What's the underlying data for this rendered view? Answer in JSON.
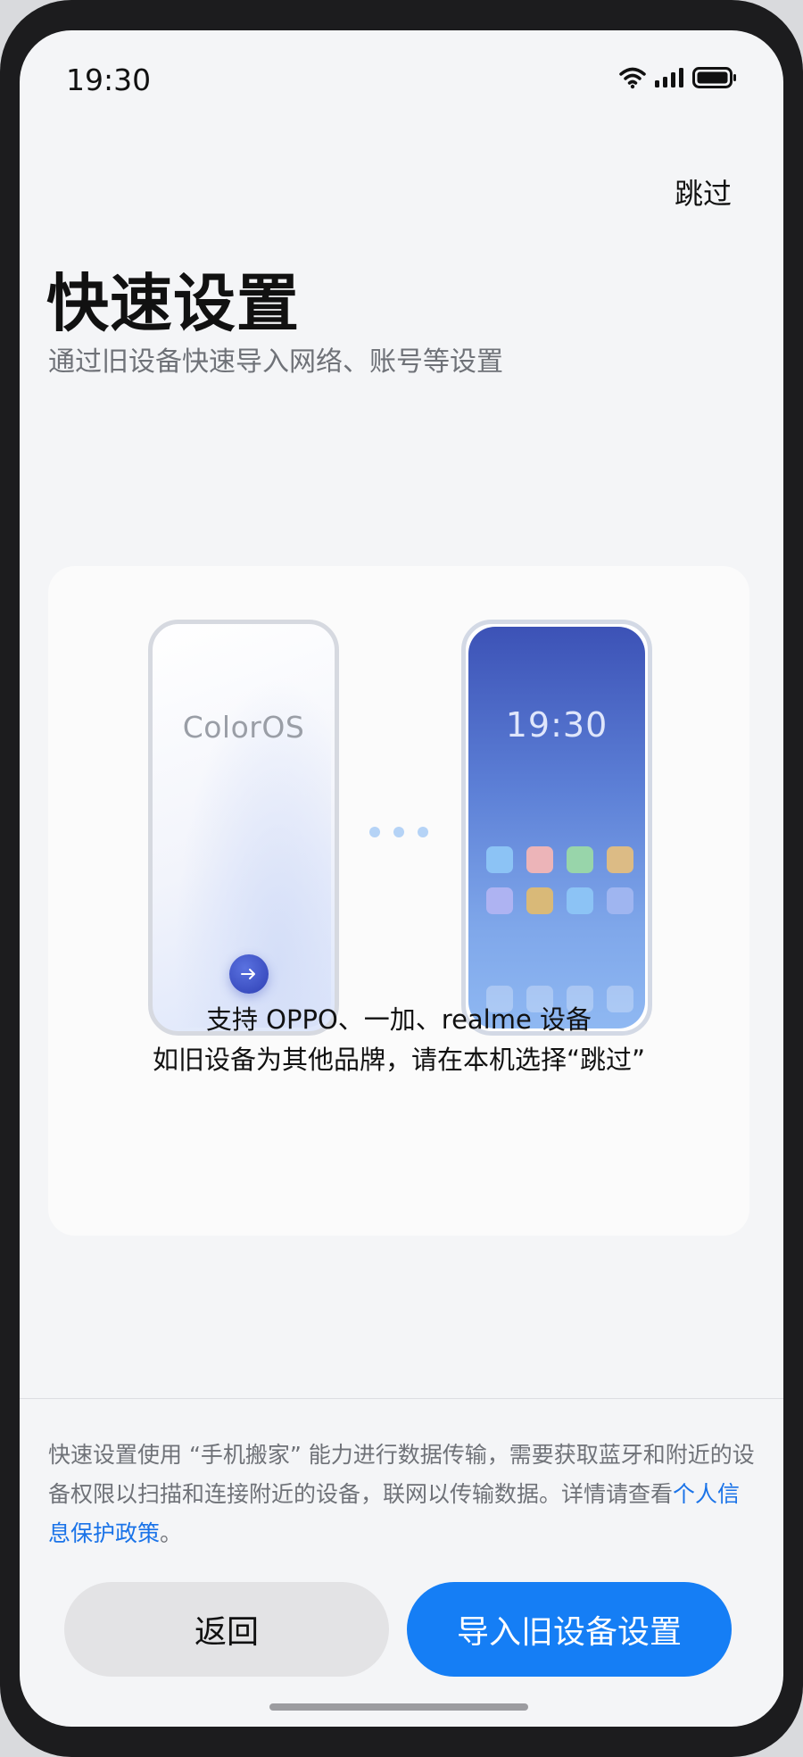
{
  "status_bar": {
    "time": "19:30",
    "icons": [
      "wifi-icon",
      "signal-icon",
      "battery-icon"
    ]
  },
  "header": {
    "skip_label": "跳过",
    "title": "快速设置",
    "subtitle": "通过旧设备快速导入网络、账号等设置"
  },
  "illustration": {
    "old_phone_brand": "ColorOS",
    "new_phone_time": "19:30",
    "arrow_icon": "arrow-right-icon",
    "app_icon_colors": [
      "#8cc3f5",
      "#ecb4b8",
      "#98d5aa",
      "#dcbb85",
      "#aeb3f2",
      "#d9b978",
      "#8cc3f5",
      "#9fb5f0"
    ]
  },
  "card": {
    "line1": "支持 OPPO、一加、realme 设备",
    "line2": "如旧设备为其他品牌，请在本机选择“跳过”"
  },
  "disclaimer": {
    "text": "快速设置使用 “手机搬家” 能力进行数据传输，需要获取蓝牙和附近的设备权限以扫描和连接附近的设备，联网以传输数据。详情请查看",
    "link_label": "个人信息保护政策",
    "suffix": "。"
  },
  "buttons": {
    "back_label": "返回",
    "import_label": "导入旧设备设置"
  },
  "colors": {
    "accent": "#157ef5",
    "link": "#1a73e8",
    "background": "#f4f5f7"
  }
}
